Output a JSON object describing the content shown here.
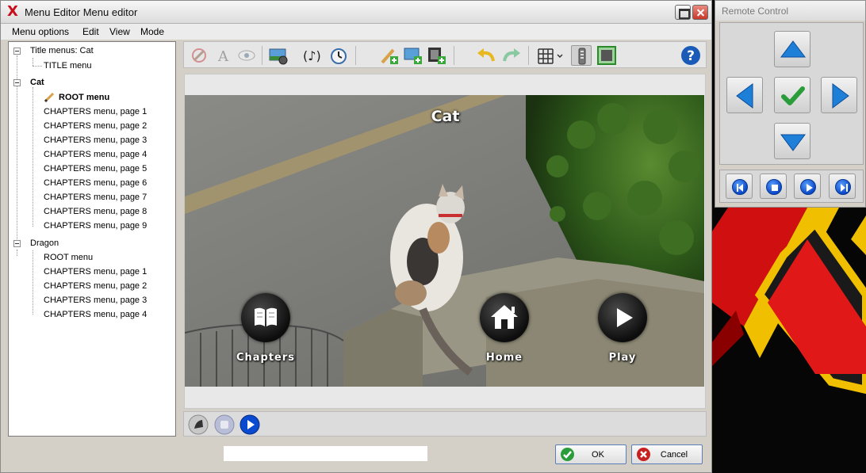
{
  "window": {
    "title": "Menu Editor Menu editor"
  },
  "menubar": {
    "items": [
      "Menu options",
      "Edit",
      "View",
      "Mode"
    ]
  },
  "tree": {
    "root_label": "Title menus: Cat",
    "title_child": "TITLE menu",
    "groups": [
      {
        "label": "Cat",
        "items": [
          "ROOT menu",
          "CHAPTERS menu, page 1",
          "CHAPTERS menu, page 2",
          "CHAPTERS menu, page 3",
          "CHAPTERS menu, page 4",
          "CHAPTERS menu, page 5",
          "CHAPTERS menu, page 6",
          "CHAPTERS menu, page 7",
          "CHAPTERS menu, page 8",
          "CHAPTERS menu, page 9"
        ]
      },
      {
        "label": "Dragon",
        "items": [
          "ROOT menu",
          "CHAPTERS menu, page 1",
          "CHAPTERS menu, page 2",
          "CHAPTERS menu, page 3",
          "CHAPTERS menu, page 4"
        ]
      }
    ],
    "selected": "Cat / ROOT menu"
  },
  "toolbar": {
    "icons": [
      "eraser-icon",
      "text-icon",
      "eye-icon",
      "background-settings-icon",
      "audio-icon",
      "timer-icon",
      "add-button-icon",
      "add-image-icon",
      "add-video-icon",
      "undo-icon",
      "redo-icon",
      "grid-icon",
      "remote-icon",
      "safe-area-icon",
      "help-icon"
    ],
    "help_label": "?"
  },
  "preview": {
    "menu_title": "Cat",
    "buttons": [
      {
        "label": "Chapters",
        "icon": "book-icon"
      },
      {
        "label": "Home",
        "icon": "home-icon"
      },
      {
        "label": "Play",
        "icon": "play-icon"
      }
    ]
  },
  "footer": {
    "ok_label": "OK",
    "cancel_label": "Cancel"
  },
  "remote": {
    "title": "Remote Control"
  },
  "colors": {
    "accent_blue": "#1e7fd8",
    "ok_green": "#2a9d3a",
    "cancel_red": "#c82020",
    "logo_red": "#c8101a"
  }
}
